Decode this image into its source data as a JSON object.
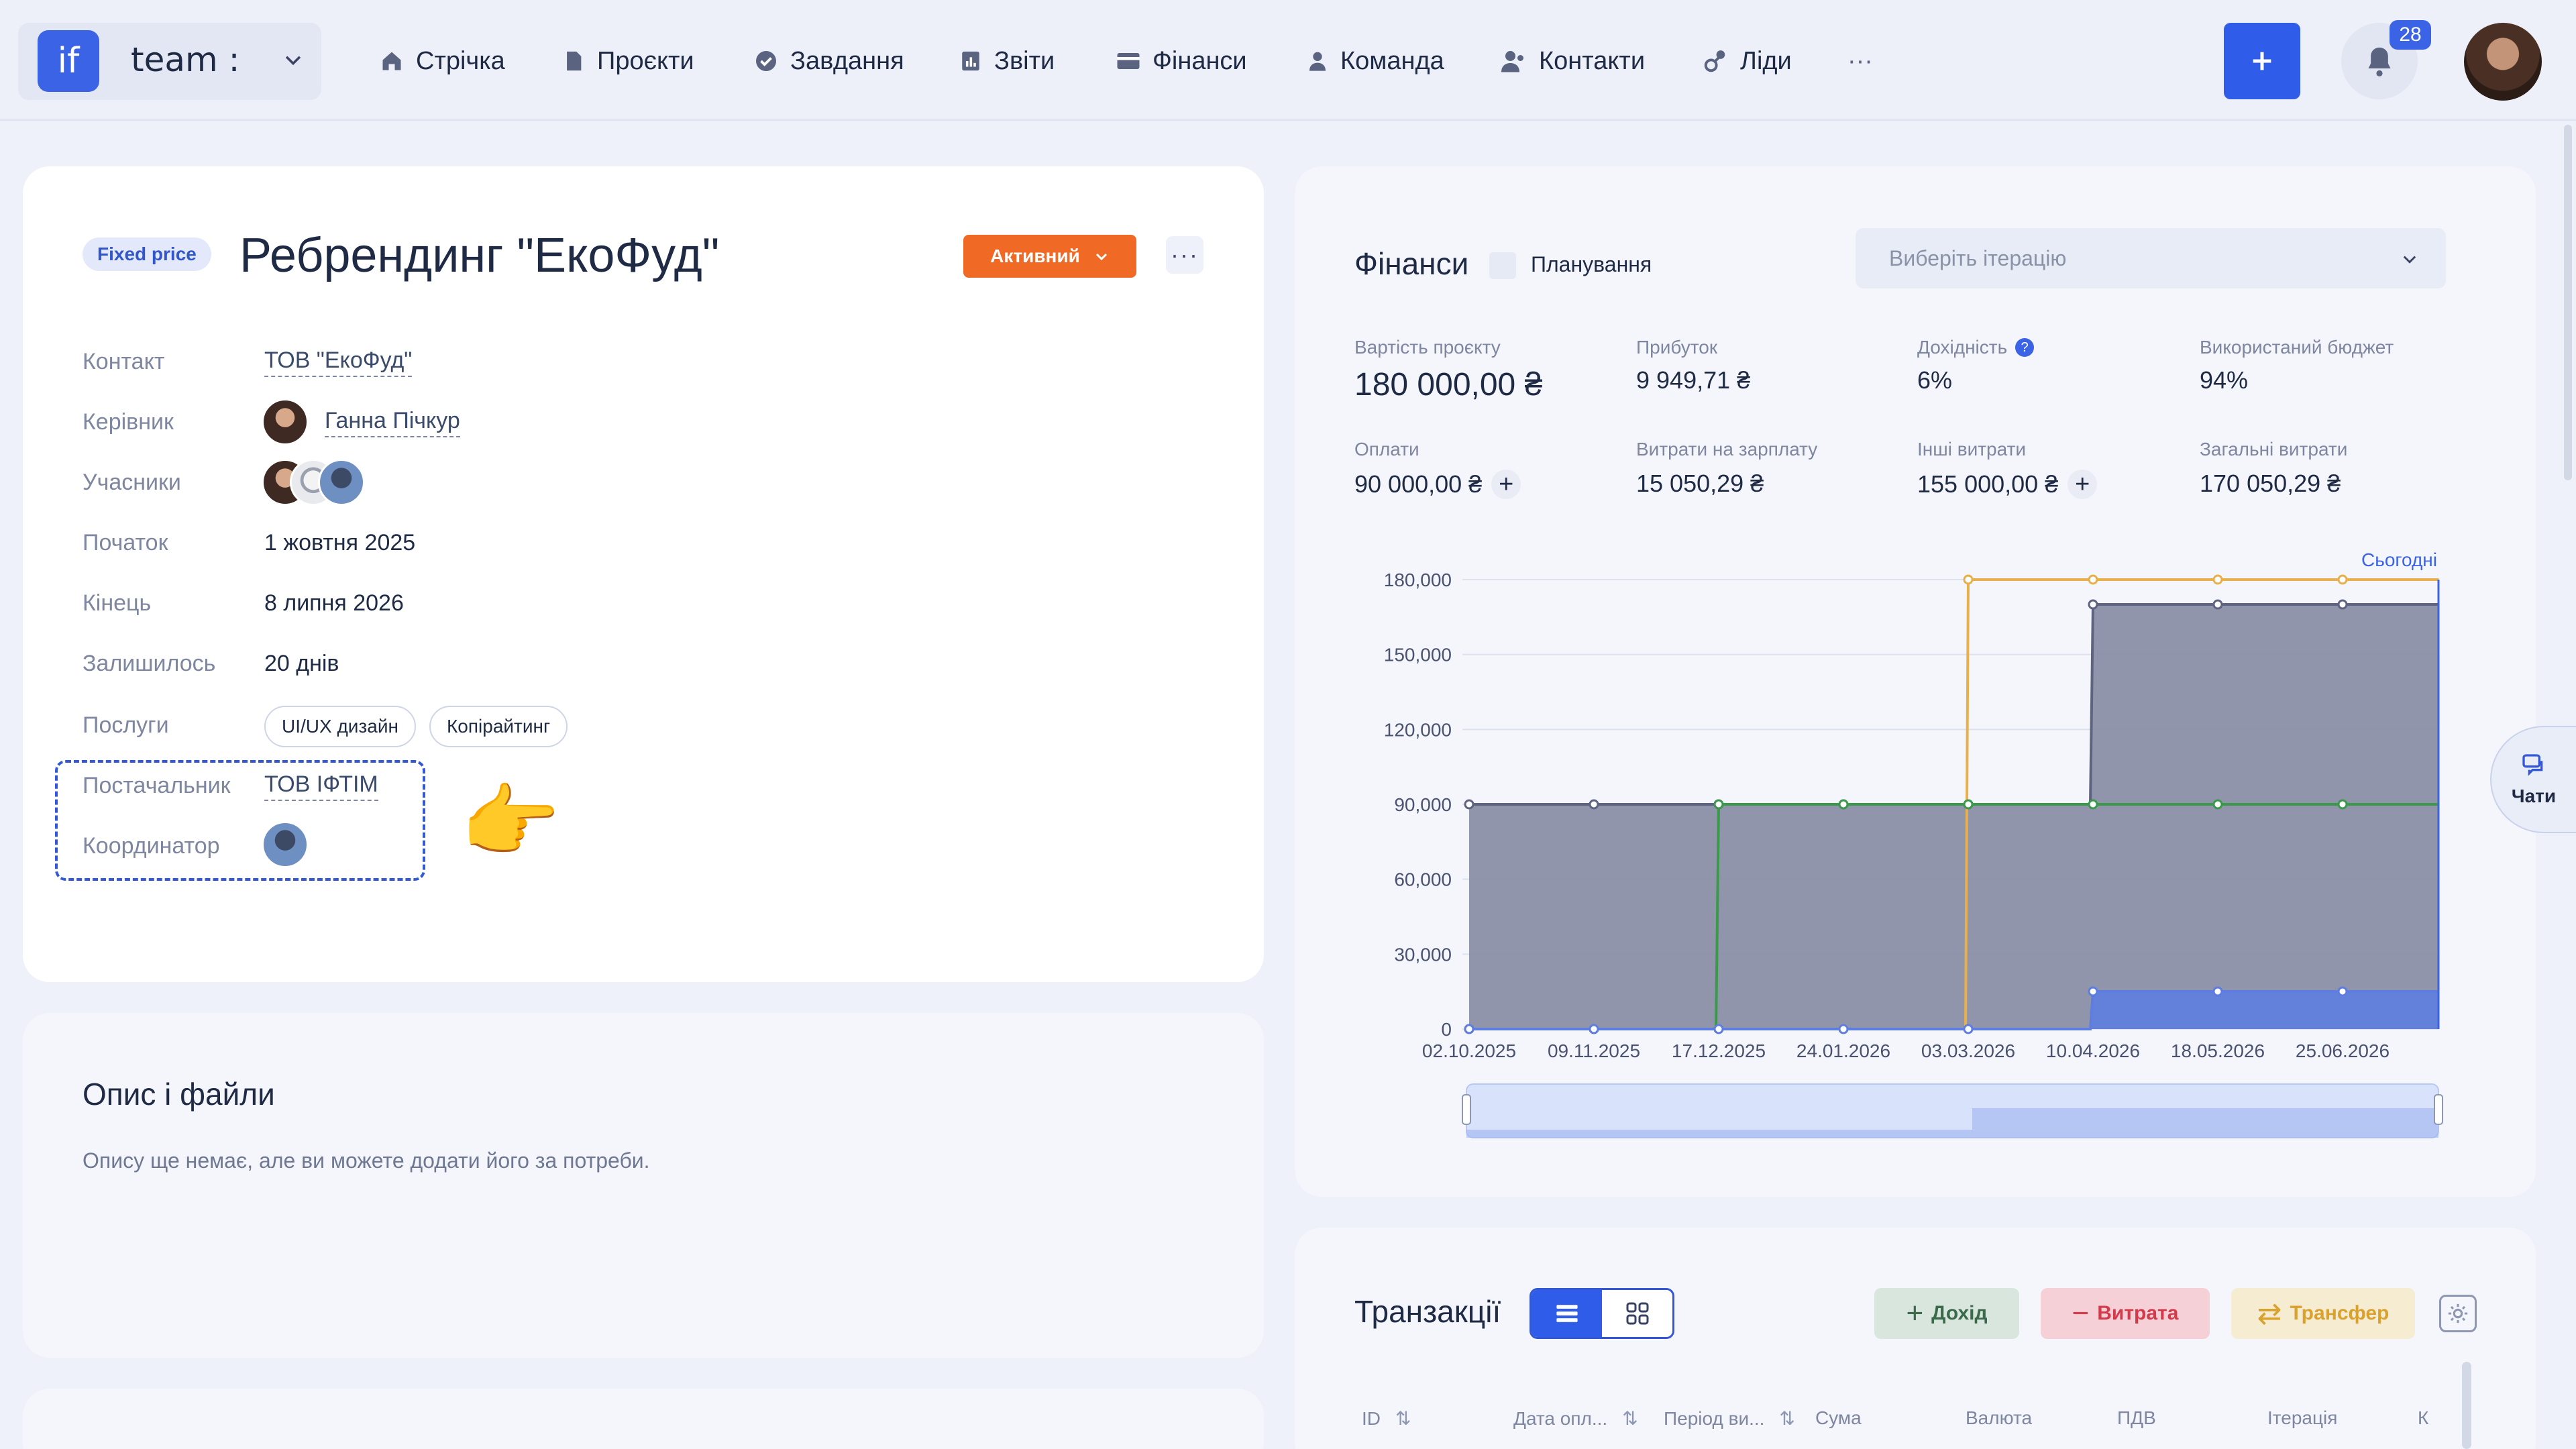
{
  "app": {
    "team_logo": "if",
    "team_name": "team :"
  },
  "nav": [
    {
      "label": "Стрічка",
      "icon": "home-icon"
    },
    {
      "label": "Проєкти",
      "icon": "document-icon"
    },
    {
      "label": "Завдання",
      "icon": "check-circle-icon"
    },
    {
      "label": "Звіти",
      "icon": "report-icon"
    },
    {
      "label": "Фінанси",
      "icon": "wallet-icon"
    },
    {
      "label": "Команда",
      "icon": "person-icon"
    },
    {
      "label": "Контакти",
      "icon": "contacts-icon"
    },
    {
      "label": "Ліди",
      "icon": "leads-icon"
    },
    {
      "label": "···",
      "icon": "more-icon"
    }
  ],
  "notifications": {
    "count": "28"
  },
  "project": {
    "pricing": "Fixed price",
    "title": "Ребрендинг \"ЕкоФуд\"",
    "status": "Активний",
    "more": "···",
    "fields": {
      "contact_label": "Контакт",
      "contact_value": "ТОВ \"ЕкоФуд\"",
      "manager_label": "Керівник",
      "manager_value": "Ганна Пічкур",
      "members_label": "Учасники",
      "start_label": "Початок",
      "start_value": "1 жовтня 2025",
      "end_label": "Кінець",
      "end_value": "8 липня 2026",
      "left_label": "Залишилось",
      "left_value": "20 днів",
      "services_label": "Послуги",
      "services": [
        "UI/UX дизайн",
        "Копірайтинг"
      ],
      "supplier_label": "Постачальник",
      "supplier_value": "ТОВ ІФТІМ",
      "coordinator_label": "Координатор"
    },
    "pointer_emoji": "👉"
  },
  "description": {
    "title": "Опис і файли",
    "empty_text": "Опису ще немає, але ви можете додати його за потреби."
  },
  "finance": {
    "title": "Фінанси",
    "planning_label": "Планування",
    "iteration_placeholder": "Виберіть ітерацію",
    "kpis": {
      "cost_label": "Вартість проєкту",
      "cost_value": "180 000,00 ₴",
      "profit_label": "Прибуток",
      "profit_value": "9 949,71 ₴",
      "yield_label": "Дохідність",
      "yield_value": "6%",
      "budget_label": "Використаний бюджет",
      "budget_value": "94%",
      "payments_label": "Оплати",
      "payments_value": "90 000,00 ₴",
      "salary_label": "Витрати на зарплату",
      "salary_value": "15 050,29 ₴",
      "other_label": "Інші витрати",
      "other_value": "155 000,00 ₴",
      "total_label": "Загальні витрати",
      "total_value": "170 050,29 ₴"
    }
  },
  "chart_data": {
    "type": "line",
    "today_label": "Сьогодні",
    "x": [
      "02.10.2025",
      "09.11.2025",
      "17.12.2025",
      "24.01.2026",
      "03.03.2026",
      "10.04.2026",
      "18.05.2026",
      "25.06.2026"
    ],
    "y_ticks": [
      "0",
      "30,000",
      "60,000",
      "90,000",
      "120,000",
      "150,000",
      "180,000"
    ],
    "ylim": [
      0,
      180000
    ],
    "series": [
      {
        "color": "#8a8fa6",
        "fill": true,
        "values": [
          90000,
          90000,
          90000,
          90000,
          90000,
          170050,
          170050,
          170050
        ]
      },
      {
        "color": "#e7b04a",
        "fill": false,
        "values": [
          0,
          0,
          0,
          0,
          180000,
          180000,
          180000,
          180000
        ]
      },
      {
        "color": "#3a9a4a",
        "fill": false,
        "values": [
          0,
          0,
          90000,
          90000,
          90000,
          90000,
          90000,
          90000
        ]
      },
      {
        "color": "#5e7de0",
        "fill": true,
        "values": [
          0,
          0,
          0,
          0,
          0,
          15050,
          15050,
          15050
        ]
      }
    ]
  },
  "transactions": {
    "title": "Транзакції",
    "income_label": "Дохід",
    "expense_label": "Витрата",
    "transfer_label": "Трансфер",
    "columns": [
      "ID",
      "Дата опл...",
      "Період ви...",
      "Сума",
      "Валюта",
      "ПДВ",
      "Ітерація",
      "К"
    ]
  },
  "chats": {
    "label": "Чати"
  },
  "colors": {
    "accent": "#2f5ce8",
    "status_active": "#f06a26",
    "income_bg": "#d9e6de",
    "expense_bg": "#f5d0d6",
    "transfer_bg": "#f6ecd2"
  }
}
